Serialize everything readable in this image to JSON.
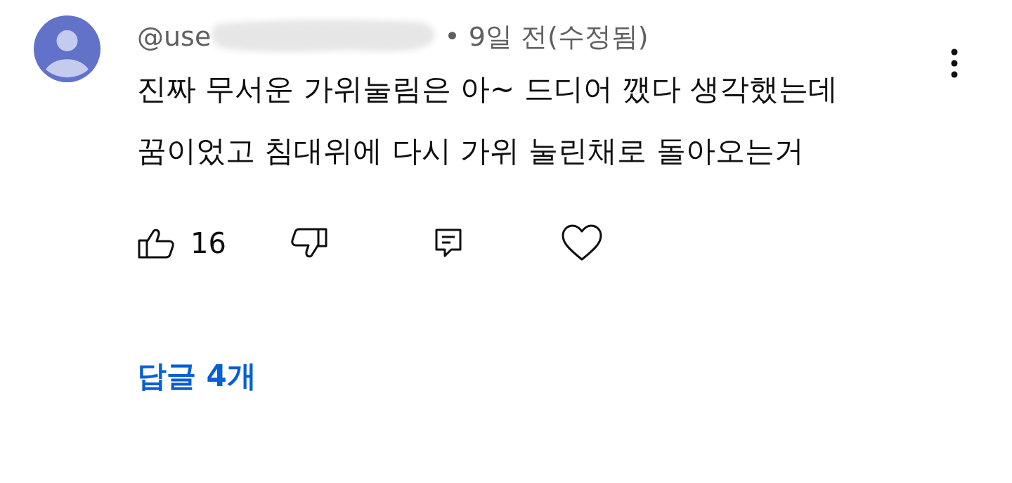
{
  "comment": {
    "author": "@use",
    "time": "• 9일 전(수정됨)",
    "text": "진짜 무서운 가위눌림은 아~ 드디어 깼다 생각했는데 꿈이었고 침대위에 다시 가위 눌린채로 돌아오는거",
    "likes": "16",
    "liked": false,
    "disliked": false,
    "hearted": false
  },
  "replies": {
    "label": "답글 4개"
  }
}
